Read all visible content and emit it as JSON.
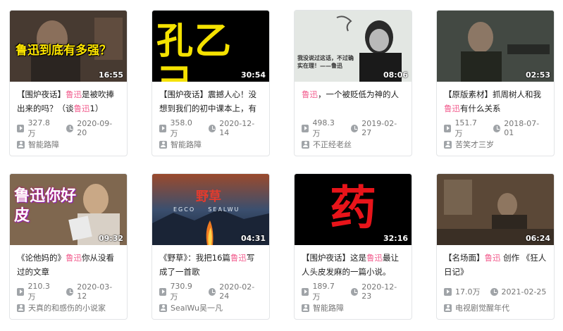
{
  "videos": [
    {
      "thumb_text": "鲁迅到底有多强？",
      "duration": "16:55",
      "title_parts": [
        "【围炉夜话】",
        "鲁迅",
        "是被吹捧出来的吗？（谈",
        "鲁迅",
        "1）"
      ],
      "views": "327.8万",
      "date": "2020-09-20",
      "uploader": "智能路障"
    },
    {
      "thumb_text": "孔乙己",
      "duration": "30:54",
      "title_parts": [
        "【围炉夜话】震撼人心！没想到我们的初中课本上，有",
        "",
        "",
        "",
        ""
      ],
      "views": "358.0万",
      "date": "2020-12-14",
      "uploader": "智能路障"
    },
    {
      "thumb_text": "我没说过这话，不过确实在理！——鲁迅",
      "duration": "08:06",
      "title_parts": [
        "",
        "鲁迅",
        "，一个被贬低为神的人",
        "",
        ""
      ],
      "views": "498.3万",
      "date": "2019-02-27",
      "uploader": "不正经老丝"
    },
    {
      "thumb_text": "",
      "duration": "02:53",
      "title_parts": [
        "【原版素材】抓周树人和我",
        "鲁迅",
        "有什么关系",
        "",
        ""
      ],
      "views": "151.7万",
      "date": "2018-07-01",
      "uploader": "苦笑才三岁"
    },
    {
      "thumb_text": "鲁迅你好皮",
      "duration": "09:32",
      "title_parts": [
        "《论他妈的》",
        "鲁迅",
        "你从没看过的文章",
        "",
        ""
      ],
      "views": "210.3万",
      "date": "2020-03-12",
      "uploader": "天真的和感伤的小说家"
    },
    {
      "thumb_text": "野草",
      "thumb_sub": "EGCO    SEALWU",
      "duration": "04:31",
      "title_parts": [
        "《野草》：我把16篇",
        "鲁迅",
        "写成了一首歌",
        "",
        ""
      ],
      "views": "730.9万",
      "date": "2020-02-24",
      "uploader": "SealWu吴一凡"
    },
    {
      "thumb_text": "药",
      "duration": "32:16",
      "title_parts": [
        "【围炉夜话】这是",
        "鲁迅",
        "最让人头皮发麻的一篇小说。",
        "",
        ""
      ],
      "views": "189.7万",
      "date": "2020-12-23",
      "uploader": "智能路障"
    },
    {
      "thumb_text": "",
      "duration": "06:24",
      "title_parts": [
        "【名场面】",
        "鲁迅",
        " 创作 《狂人日记》",
        "",
        ""
      ],
      "views": "17.0万",
      "date": "2021-02-25",
      "uploader": "电视剧觉醒年代"
    }
  ],
  "colors": {
    "highlight": "#f25d8e",
    "meta": "#757575",
    "border": "#e3e5e7"
  }
}
